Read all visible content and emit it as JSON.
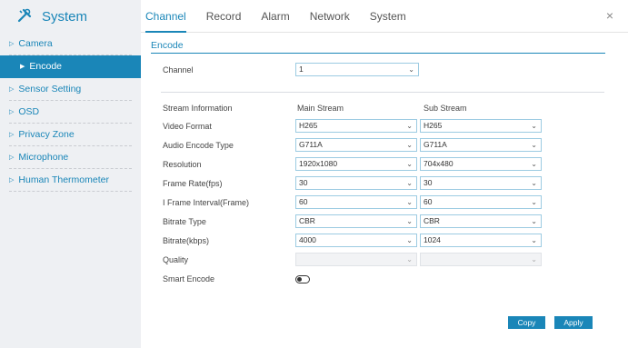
{
  "app": {
    "title": "System",
    "close_label": "×"
  },
  "tabs": [
    {
      "label": "Channel"
    },
    {
      "label": "Record"
    },
    {
      "label": "Alarm"
    },
    {
      "label": "Network"
    },
    {
      "label": "System"
    }
  ],
  "sidebar": {
    "items": [
      {
        "label": "Camera"
      },
      {
        "label": "Encode"
      },
      {
        "label": "Sensor Setting"
      },
      {
        "label": "OSD"
      },
      {
        "label": "Privacy Zone"
      },
      {
        "label": "Microphone"
      },
      {
        "label": "Human Thermometer"
      }
    ],
    "active_index": 1
  },
  "encode": {
    "section_title": "Encode",
    "channel_label": "Channel",
    "channel_value": "1",
    "stream_info_label": "Stream Information",
    "main_stream_label": "Main Stream",
    "sub_stream_label": "Sub Stream",
    "rows": [
      {
        "label": "Video Format",
        "main": "H265",
        "sub": "H265"
      },
      {
        "label": "Audio Encode Type",
        "main": "G711A",
        "sub": "G711A"
      },
      {
        "label": "Resolution",
        "main": "1920x1080",
        "sub": "704x480"
      },
      {
        "label": "Frame Rate(fps)",
        "main": "30",
        "sub": "30"
      },
      {
        "label": "I Frame Interval(Frame)",
        "main": "60",
        "sub": "60"
      },
      {
        "label": "Bitrate Type",
        "main": "CBR",
        "sub": "CBR"
      },
      {
        "label": "Bitrate(kbps)",
        "main": "4000",
        "sub": "1024"
      },
      {
        "label": "Quality",
        "main": "",
        "sub": ""
      }
    ],
    "smart_encode_label": "Smart Encode",
    "smart_encode_on": false,
    "copy_label": "Copy",
    "apply_label": "Apply"
  },
  "colors": {
    "accent": "#1a86b8",
    "sidebar_bg": "#eef0f3"
  }
}
